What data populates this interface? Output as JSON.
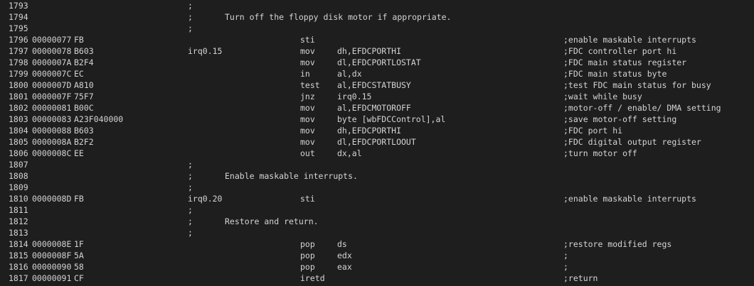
{
  "lines": [
    {
      "num": "1793",
      "addr": "",
      "bytes": "",
      "label": "",
      "semi": ";",
      "ctext": "",
      "op": "",
      "args": "",
      "trail": ""
    },
    {
      "num": "1794",
      "addr": "",
      "bytes": "",
      "label": "",
      "semi": ";",
      "ctext": "Turn off the floppy disk motor if appropriate.",
      "op": "",
      "args": "",
      "trail": ""
    },
    {
      "num": "1795",
      "addr": "",
      "bytes": "",
      "label": "",
      "semi": ";",
      "ctext": "",
      "op": "",
      "args": "",
      "trail": ""
    },
    {
      "num": "1796",
      "addr": "00000077",
      "bytes": "FB",
      "label": "",
      "semi": "",
      "ctext": "",
      "op": "sti",
      "args": "",
      "trail": ";enable maskable interrupts"
    },
    {
      "num": "1797",
      "addr": "00000078",
      "bytes": "B603",
      "label": "irq0.15",
      "semi": "",
      "ctext": "",
      "op": "mov",
      "args": "dh,EFDCPORTHI",
      "trail": ";FDC controller port hi"
    },
    {
      "num": "1798",
      "addr": "0000007A",
      "bytes": "B2F4",
      "label": "",
      "semi": "",
      "ctext": "",
      "op": "mov",
      "args": "dl,EFDCPORTLOSTAT",
      "trail": ";FDC main status register"
    },
    {
      "num": "1799",
      "addr": "0000007C",
      "bytes": "EC",
      "label": "",
      "semi": "",
      "ctext": "",
      "op": "in",
      "args": "al,dx",
      "trail": ";FDC main status byte"
    },
    {
      "num": "1800",
      "addr": "0000007D",
      "bytes": "A810",
      "label": "",
      "semi": "",
      "ctext": "",
      "op": "test",
      "args": "al,EFDCSTATBUSY",
      "trail": ";test FDC main status for busy"
    },
    {
      "num": "1801",
      "addr": "0000007F",
      "bytes": "75F7",
      "label": "",
      "semi": "",
      "ctext": "",
      "op": "jnz",
      "args": "irq0.15",
      "trail": ";wait while busy"
    },
    {
      "num": "1802",
      "addr": "00000081",
      "bytes": "B00C",
      "label": "",
      "semi": "",
      "ctext": "",
      "op": "mov",
      "args": "al,EFDCMOTOROFF",
      "trail": ";motor-off / enable/ DMA setting"
    },
    {
      "num": "1803",
      "addr": "00000083",
      "bytes": "A23F040000",
      "label": "",
      "semi": "",
      "ctext": "",
      "op": "mov",
      "args": "byte [wbFDCControl],al",
      "trail": ";save motor-off setting"
    },
    {
      "num": "1804",
      "addr": "00000088",
      "bytes": "B603",
      "label": "",
      "semi": "",
      "ctext": "",
      "op": "mov",
      "args": "dh,EFDCPORTHI",
      "trail": ";FDC port hi"
    },
    {
      "num": "1805",
      "addr": "0000008A",
      "bytes": "B2F2",
      "label": "",
      "semi": "",
      "ctext": "",
      "op": "mov",
      "args": "dl,EFDCPORTLOOUT",
      "trail": ";FDC digital output register"
    },
    {
      "num": "1806",
      "addr": "0000008C",
      "bytes": "EE",
      "label": "",
      "semi": "",
      "ctext": "",
      "op": "out",
      "args": "dx,al",
      "trail": ";turn motor off"
    },
    {
      "num": "1807",
      "addr": "",
      "bytes": "",
      "label": "",
      "semi": ";",
      "ctext": "",
      "op": "",
      "args": "",
      "trail": ""
    },
    {
      "num": "1808",
      "addr": "",
      "bytes": "",
      "label": "",
      "semi": ";",
      "ctext": "Enable maskable interrupts.",
      "op": "",
      "args": "",
      "trail": ""
    },
    {
      "num": "1809",
      "addr": "",
      "bytes": "",
      "label": "",
      "semi": ";",
      "ctext": "",
      "op": "",
      "args": "",
      "trail": ""
    },
    {
      "num": "1810",
      "addr": "0000008D",
      "bytes": "FB",
      "label": "irq0.20",
      "semi": "",
      "ctext": "",
      "op": "sti",
      "args": "",
      "trail": ";enable maskable interrupts"
    },
    {
      "num": "1811",
      "addr": "",
      "bytes": "",
      "label": "",
      "semi": ";",
      "ctext": "",
      "op": "",
      "args": "",
      "trail": ""
    },
    {
      "num": "1812",
      "addr": "",
      "bytes": "",
      "label": "",
      "semi": ";",
      "ctext": "Restore and return.",
      "op": "",
      "args": "",
      "trail": ""
    },
    {
      "num": "1813",
      "addr": "",
      "bytes": "",
      "label": "",
      "semi": ";",
      "ctext": "",
      "op": "",
      "args": "",
      "trail": ""
    },
    {
      "num": "1814",
      "addr": "0000008E",
      "bytes": "1F",
      "label": "",
      "semi": "",
      "ctext": "",
      "op": "pop",
      "args": "ds",
      "trail": ";restore modified regs"
    },
    {
      "num": "1815",
      "addr": "0000008F",
      "bytes": "5A",
      "label": "",
      "semi": "",
      "ctext": "",
      "op": "pop",
      "args": "edx",
      "trail": ";"
    },
    {
      "num": "1816",
      "addr": "00000090",
      "bytes": "58",
      "label": "",
      "semi": "",
      "ctext": "",
      "op": "pop",
      "args": "eax",
      "trail": ";"
    },
    {
      "num": "1817",
      "addr": "00000091",
      "bytes": "CF",
      "label": "",
      "semi": "",
      "ctext": "",
      "op": "iretd",
      "args": "",
      "trail": ";return"
    }
  ]
}
